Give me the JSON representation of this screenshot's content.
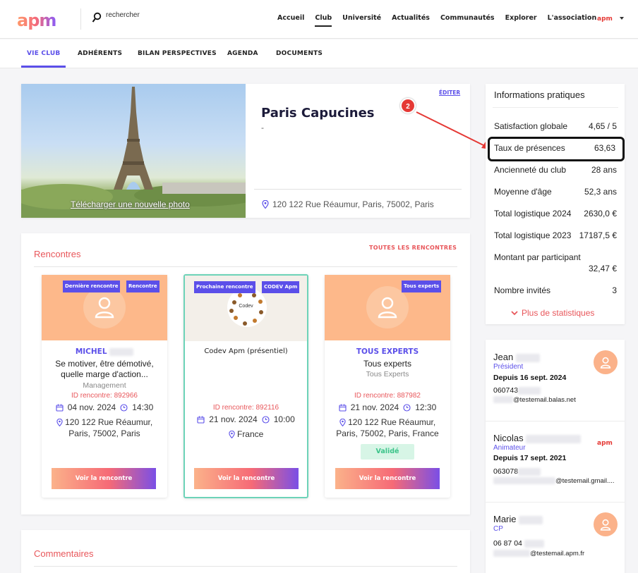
{
  "header": {
    "logo": "apm",
    "search_placeholder": "rechercher",
    "nav": [
      "Accueil",
      "Club",
      "Université",
      "Actualités",
      "Communautés",
      "Explorer",
      "L'association"
    ],
    "user_brand": "apm"
  },
  "subnav": [
    "VIE CLUB",
    "ADHÉRENTS",
    "BILAN PERSPECTIVES",
    "AGENDA",
    "DOCUMENTS"
  ],
  "club": {
    "photo_link": "Télécharger une nouvelle photo",
    "edit": "ÉDITER",
    "name": "Paris Capucines",
    "subtitle": "-",
    "address": "120 122 Rue Réaumur, Paris, 75002, Paris"
  },
  "annotation": {
    "step": "2"
  },
  "rencontres": {
    "title": "Rencontres",
    "all_link": "TOUTES LES RENCONTRES",
    "cards": [
      {
        "tags": [
          "Dernière rencontre",
          "Rencontre"
        ],
        "name": "MICHEL",
        "subject": "Se motiver, être démotivé, quelle marge d'action...",
        "category": "Management",
        "id": "ID rencontre: 892966",
        "date": "04 nov. 2024",
        "time": "14:30",
        "location": "120 122 Rue Réaumur, Paris, 75002, Paris",
        "button": "Voir la rencontre"
      },
      {
        "tags": [
          "Prochaine rencontre",
          "CODEV Apm"
        ],
        "logo_text": "Codev",
        "subject": "Codev Apm (présentiel)",
        "id": "ID rencontre: 892116",
        "date": "21 nov. 2024",
        "time": "10:00",
        "location": "France",
        "button": "Voir la rencontre"
      },
      {
        "tags": [
          "Tous experts"
        ],
        "name": "TOUS EXPERTS",
        "subject": "Tous experts",
        "category": "Tous Experts",
        "id": "ID rencontre: 887982",
        "date": "21 nov. 2024",
        "time": "12:30",
        "location": "120 122 Rue Réaumur, Paris, 75002, Paris, France",
        "status": "Validé",
        "button": "Voir la rencontre"
      }
    ]
  },
  "commentaires": {
    "title": "Commentaires"
  },
  "infos": {
    "title": "Informations pratiques",
    "rows": [
      {
        "label": "Satisfaction globale",
        "value": "4,65 / 5"
      },
      {
        "label": "Taux de présences",
        "value": "63,63"
      },
      {
        "label": "Ancienneté du club",
        "value": "28 ans"
      },
      {
        "label": "Moyenne d'âge",
        "value": "52,3 ans"
      },
      {
        "label": "Total logistique 2024",
        "value": "2630,0 €"
      },
      {
        "label": "Total logistique 2023",
        "value": "17187,5 €"
      },
      {
        "label": "Montant par participant",
        "value": "32,47 €"
      },
      {
        "label": "Nombre invités",
        "value": "3"
      }
    ],
    "more": "Plus de statistiques"
  },
  "members": [
    {
      "name": "Jean",
      "role": "Président",
      "since": "Depuis 16 sept. 2024",
      "phone": "060743",
      "email": "@testemail.balas.net"
    },
    {
      "name": "Nicolas",
      "role": "Animateur",
      "since": "Depuis 17 sept. 2021",
      "phone": "063078",
      "email": "@testemail.gmail....",
      "brand": "apm"
    },
    {
      "name": "Marie",
      "role": "CP",
      "phone": "06 87 04",
      "email": "@testemail.apm.fr"
    }
  ]
}
